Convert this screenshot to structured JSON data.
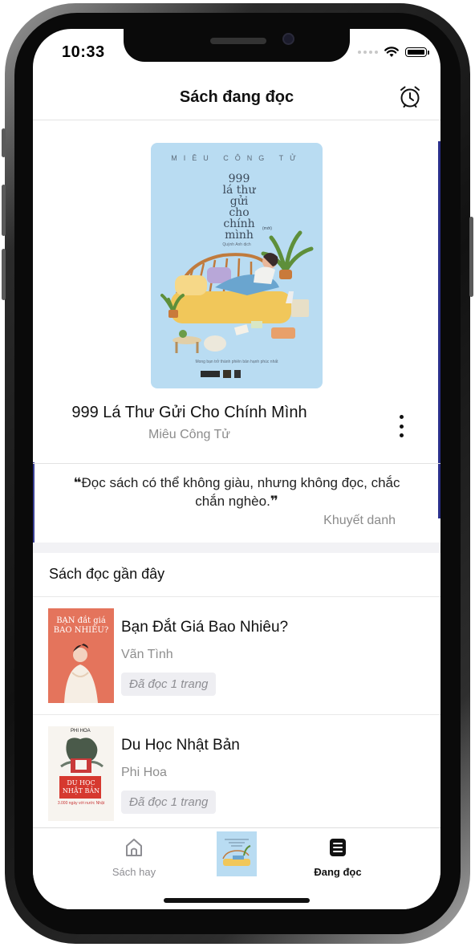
{
  "status_bar": {
    "time": "10:33"
  },
  "header": {
    "title": "Sách đang đọc",
    "alarm_icon": "alarm-clock-icon"
  },
  "current_book": {
    "title": "999 Lá Thư Gửi Cho Chính Mình",
    "author": "Miêu Công Tử",
    "cover": {
      "top_author": "MIÊU CÔNG TỬ",
      "title_lines": [
        "999",
        "lá thư",
        "gửi",
        "cho",
        "chính",
        "mình"
      ],
      "volume_tag": "(mới)",
      "translator": "Quỳnh Anh dịch",
      "tagline": "Mong bạn trở thành phiên bản hạnh phúc nhất",
      "bg_color": "#b9dcf2"
    }
  },
  "quote": {
    "text": "Đọc sách có thể không giàu, nhưng không đọc, chắc chắn nghèo.",
    "open_mark": "❝",
    "close_mark": "❞",
    "author": "Khuyết danh"
  },
  "recent": {
    "section_title": "Sách đọc gần đây",
    "items": [
      {
        "title": "Bạn Đắt Giá Bao Nhiêu?",
        "author": "Vãn Tình",
        "progress": "Đã đọc 1 trang",
        "cover_text": "BẠN đắt giá BAO NHIÊU?"
      },
      {
        "title": "Du Học Nhật Bản",
        "author": "Phi Hoa",
        "progress": "Đã đọc 1 trang",
        "cover_top": "PHI HOA",
        "cover_text": "DU HỌC NHẬT BẢN",
        "cover_sub": "3.000 ngày với nước Nhật"
      }
    ]
  },
  "tabbar": {
    "tabs": [
      {
        "label": "Sách hay",
        "icon": "home-icon",
        "active": false
      },
      {
        "label": "",
        "icon": "current-book-thumbnail",
        "active": false
      },
      {
        "label": "Đang đọc",
        "icon": "reading-list-icon",
        "active": true
      }
    ]
  }
}
